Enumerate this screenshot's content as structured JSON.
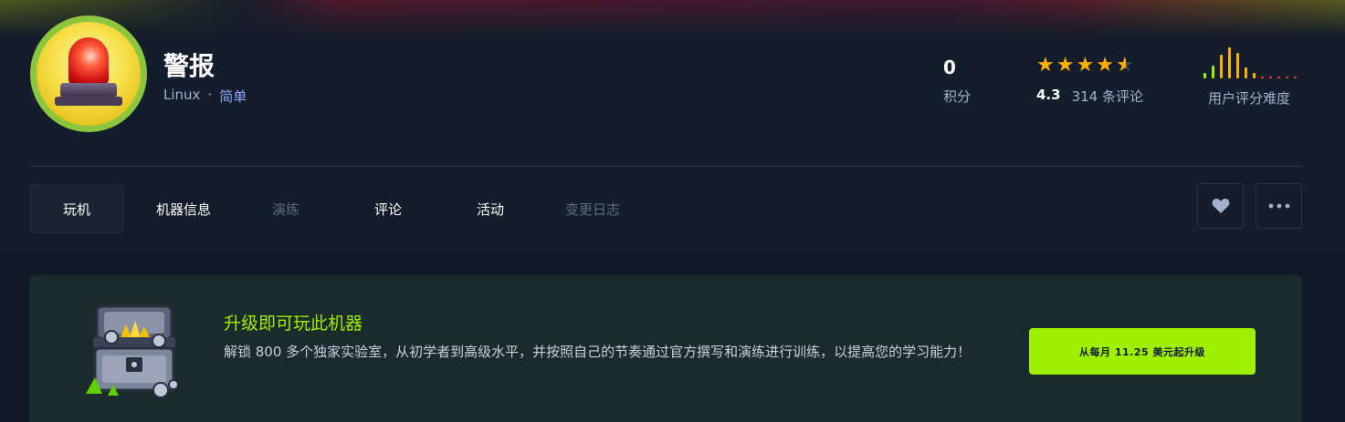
{
  "machine": {
    "name": "警报",
    "os": "Linux",
    "separator": "·",
    "difficulty": "简单"
  },
  "stats": {
    "points_value": "0",
    "points_label": "积分",
    "rating_value": "4.3",
    "rating_stars": 4.5,
    "reviews_label": "314 条评论",
    "difficulty_rating_label": "用户评分难度"
  },
  "tabs": [
    {
      "label": "玩机",
      "state": "active"
    },
    {
      "label": "机器信息",
      "state": "normal"
    },
    {
      "label": "演练",
      "state": "disabled"
    },
    {
      "label": "评论",
      "state": "normal"
    },
    {
      "label": "活动",
      "state": "normal"
    },
    {
      "label": "变更日志",
      "state": "disabled"
    }
  ],
  "actions": {
    "favorite_icon": "heart-icon",
    "more_icon": "ellipsis-icon"
  },
  "upgrade": {
    "title": "升级即可玩此机器",
    "description": "解锁 800 多个独家实验室，从初学者到高级水平，并按照自己的节奏通过官方撰写和演练进行训练，以提高您的学习能力！",
    "button_label": "从每月 11.25 美元起升级"
  },
  "colors": {
    "accent": "#9fef00",
    "star": "#ffaf00",
    "background": "#141d2b",
    "card": "#1b2a2b"
  }
}
